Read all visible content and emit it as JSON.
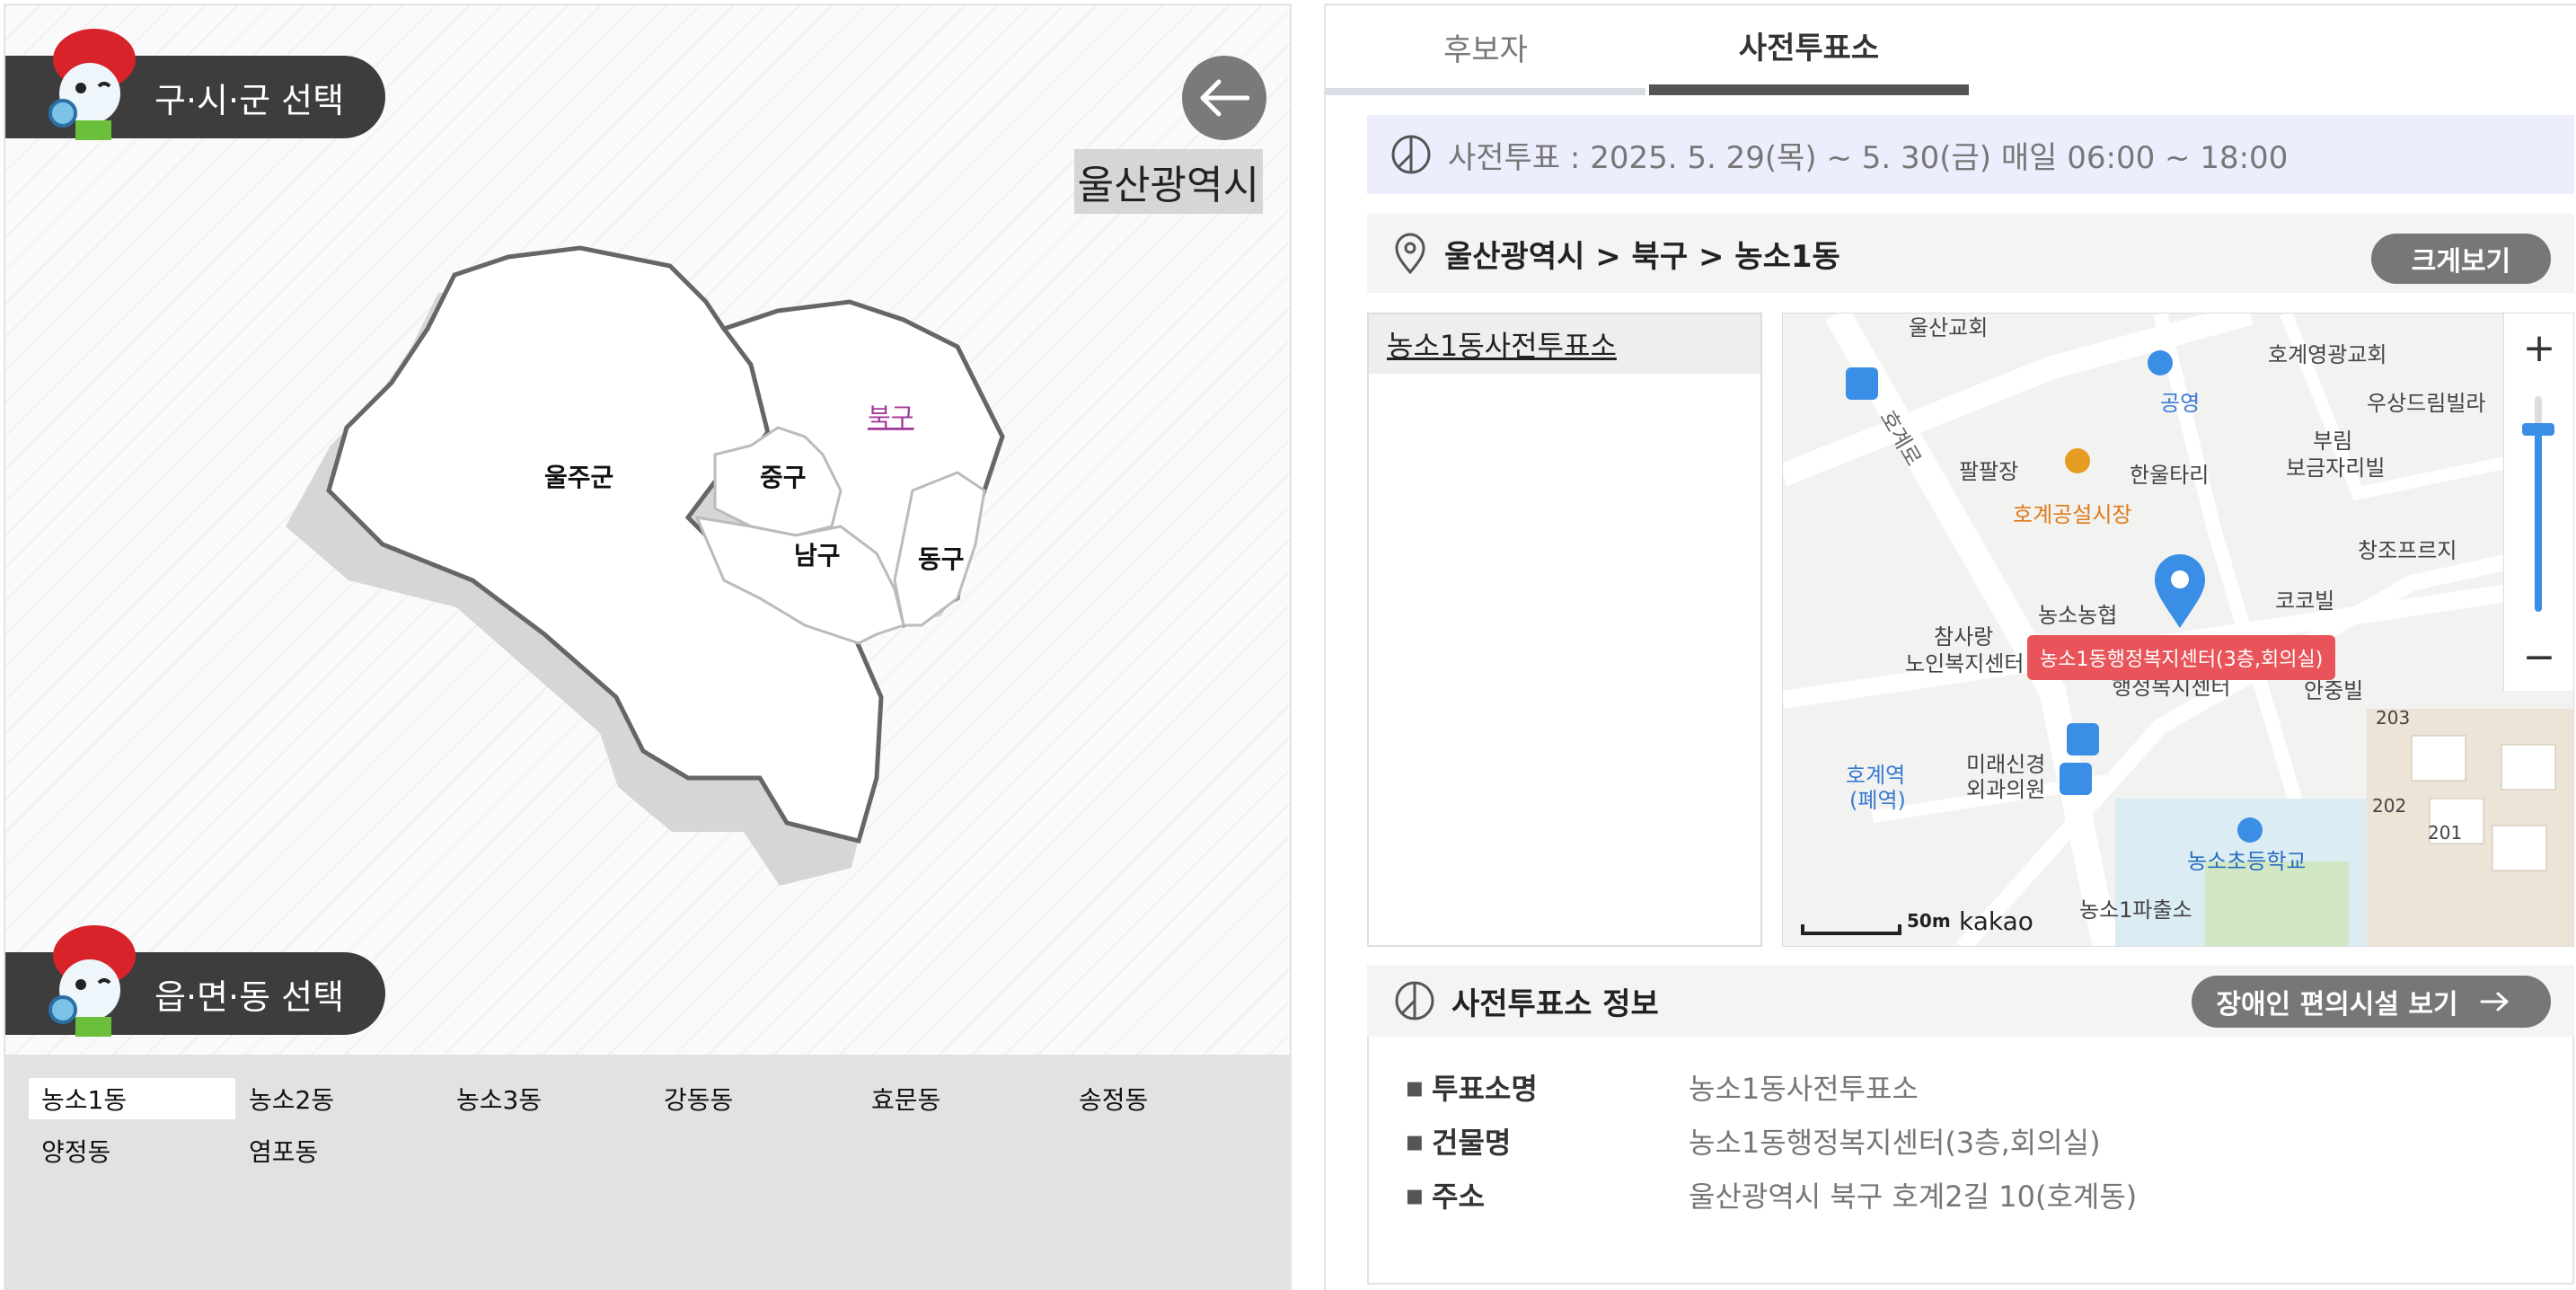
{
  "left": {
    "district_select_label": "구·시·군 선택",
    "town_select_label": "읍·면·동 선택",
    "region_title": "울산광역시",
    "map_districts": [
      "울주군",
      "중구",
      "북구",
      "남구",
      "동구"
    ],
    "dongs": [
      "농소1동",
      "농소2동",
      "농소3동",
      "강동동",
      "효문동",
      "송정동",
      "양정동",
      "염포동"
    ],
    "selected_dong": "농소1동"
  },
  "right": {
    "tabs": [
      "후보자",
      "사전투표소"
    ],
    "active_tab": "사전투표소",
    "notice": "사전투표 : 2025. 5. 29(목) ~ 5. 30(금) 매일 06:00 ~ 18:00",
    "location_path": "울산광역시 > 북구 > 농소1동",
    "enlarge_button": "크게보기",
    "places": [
      "농소1동사전투표소"
    ],
    "map": {
      "marker_label": "농소1동행정복지센터(3층,회의실)",
      "labels": [
        "울산교회",
        "호계영광교회",
        "우상드림빌라",
        "공영",
        "팔팔장",
        "한울타리",
        "부림",
        "보금자리빌",
        "호계공설시장",
        "창조프르지",
        "농소농협",
        "코코빌",
        "참사랑",
        "노인복지센터",
        "행정복지센터",
        "안중빌",
        "미래신경",
        "외과의원",
        "호계역",
        "(폐역)",
        "농소초등학교",
        "농소1파출소",
        "호계로",
        "203",
        "202",
        "201"
      ],
      "scale": "50m",
      "brand": "kakao",
      "zoom_in": "+",
      "zoom_out": "−"
    },
    "info_title": "사전투표소 정보",
    "accessibility_button": "장애인 편의시설 보기",
    "info": [
      {
        "key": "투표소명",
        "value": "농소1동사전투표소"
      },
      {
        "key": "건물명",
        "value": "농소1동행정복지센터(3층,회의실)"
      },
      {
        "key": "주소",
        "value": "울산광역시 북구 호계2길 10(호계동)"
      }
    ]
  },
  "colors": {
    "pill_bg": "#3d3d3d",
    "notice_bg": "#eceefe",
    "marker_blue": "#3a8ee6",
    "marker_label_bg": "#e9545a",
    "zoom_bar": "#3a8ee6"
  }
}
